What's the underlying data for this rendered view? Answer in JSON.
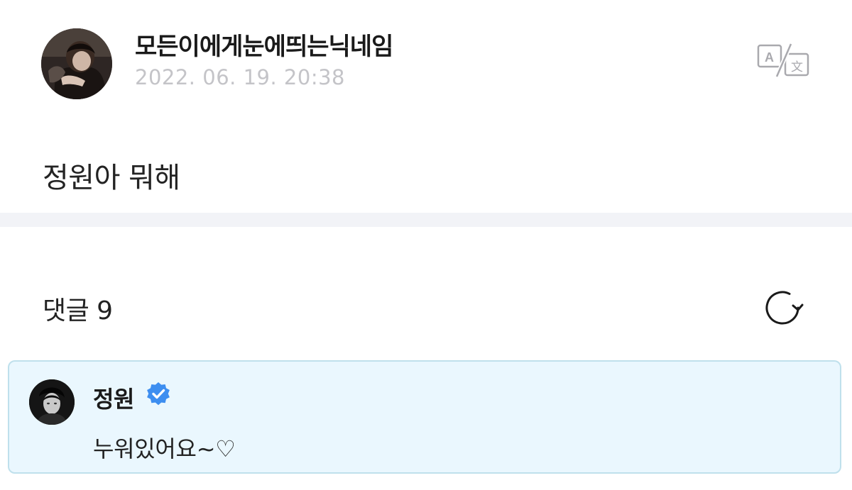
{
  "post": {
    "author": "모든이에게눈에띄는닉네임",
    "timestamp": "2022. 06. 19. 20:38",
    "body": "정원아 뭐해",
    "avatar": "profile-photo",
    "translate_icon": "translate-icon"
  },
  "comments_section": {
    "title": "댓글 9",
    "refresh_icon": "refresh-icon"
  },
  "comment": {
    "author": "정원",
    "verified_icon": "verified-badge-icon",
    "text": "누워있어요~♡",
    "avatar": "profile-photo"
  },
  "colors": {
    "highlight_background": "#eaf7fe",
    "highlight_border": "#bfe0ec",
    "verified_blue": "#3d8ef0",
    "timestamp_gray": "#c4c4c8",
    "divider": "#f2f3f7"
  }
}
